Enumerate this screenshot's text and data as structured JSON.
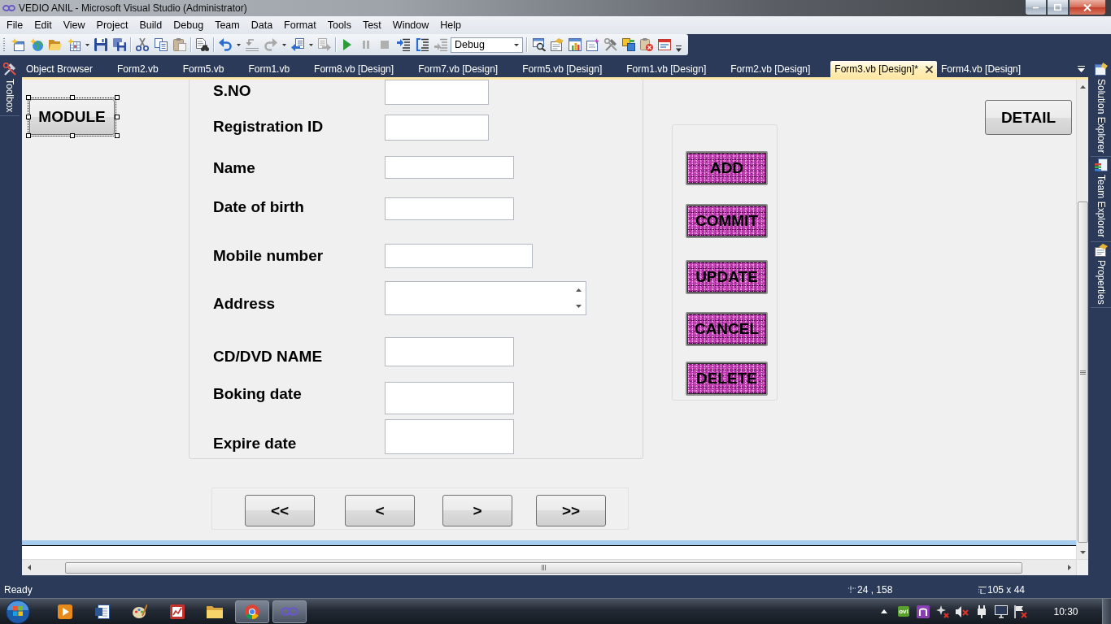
{
  "window": {
    "title": "VEDIO ANIL - Microsoft Visual Studio (Administrator)"
  },
  "menu": [
    "File",
    "Edit",
    "View",
    "Project",
    "Build",
    "Debug",
    "Team",
    "Data",
    "Format",
    "Tools",
    "Test",
    "Window",
    "Help"
  ],
  "toolbar": {
    "configuration": "Debug"
  },
  "tabs": [
    {
      "label": "Object Browser",
      "selected": false
    },
    {
      "label": "Form2.vb",
      "selected": false
    },
    {
      "label": "Form5.vb",
      "selected": false
    },
    {
      "label": "Form1.vb",
      "selected": false
    },
    {
      "label": "Form8.vb [Design]",
      "selected": false
    },
    {
      "label": "Form7.vb [Design]",
      "selected": false
    },
    {
      "label": "Form5.vb [Design]",
      "selected": false
    },
    {
      "label": "Form1.vb [Design]",
      "selected": false
    },
    {
      "label": "Form2.vb [Design]",
      "selected": false
    },
    {
      "label": "Form3.vb [Design]*",
      "selected": true
    },
    {
      "label": "Form4.vb [Design]",
      "selected": false
    }
  ],
  "side_panels": {
    "left": [
      "Toolbox"
    ],
    "right": [
      "Solution Explorer",
      "Team Explorer",
      "Properties"
    ]
  },
  "designer": {
    "module_button": {
      "label": "MODULE",
      "selected": true
    },
    "fields": [
      {
        "label": "S.NO",
        "kind": "text"
      },
      {
        "label": "Registration ID",
        "kind": "text"
      },
      {
        "label": "Name",
        "kind": "text"
      },
      {
        "label": "Date of birth",
        "kind": "text"
      },
      {
        "label": "Mobile number",
        "kind": "text"
      },
      {
        "label": "Address",
        "kind": "multiline"
      },
      {
        "label": "CD/DVD NAME",
        "kind": "text"
      },
      {
        "label": "Boking date",
        "kind": "text"
      },
      {
        "label": "Expire date",
        "kind": "text"
      }
    ],
    "actions": [
      "ADD",
      "COMMIT",
      "UPDATE",
      "CANCEL",
      "DELETE"
    ],
    "detail_button": "DETAIL",
    "navigation": [
      "<<",
      "<",
      ">",
      ">>"
    ]
  },
  "status_bar": {
    "text": "Ready",
    "position": "24 , 158",
    "size": "105 x 44"
  },
  "taskbar": {
    "tray_label": "ovi",
    "clock": "10:30"
  }
}
